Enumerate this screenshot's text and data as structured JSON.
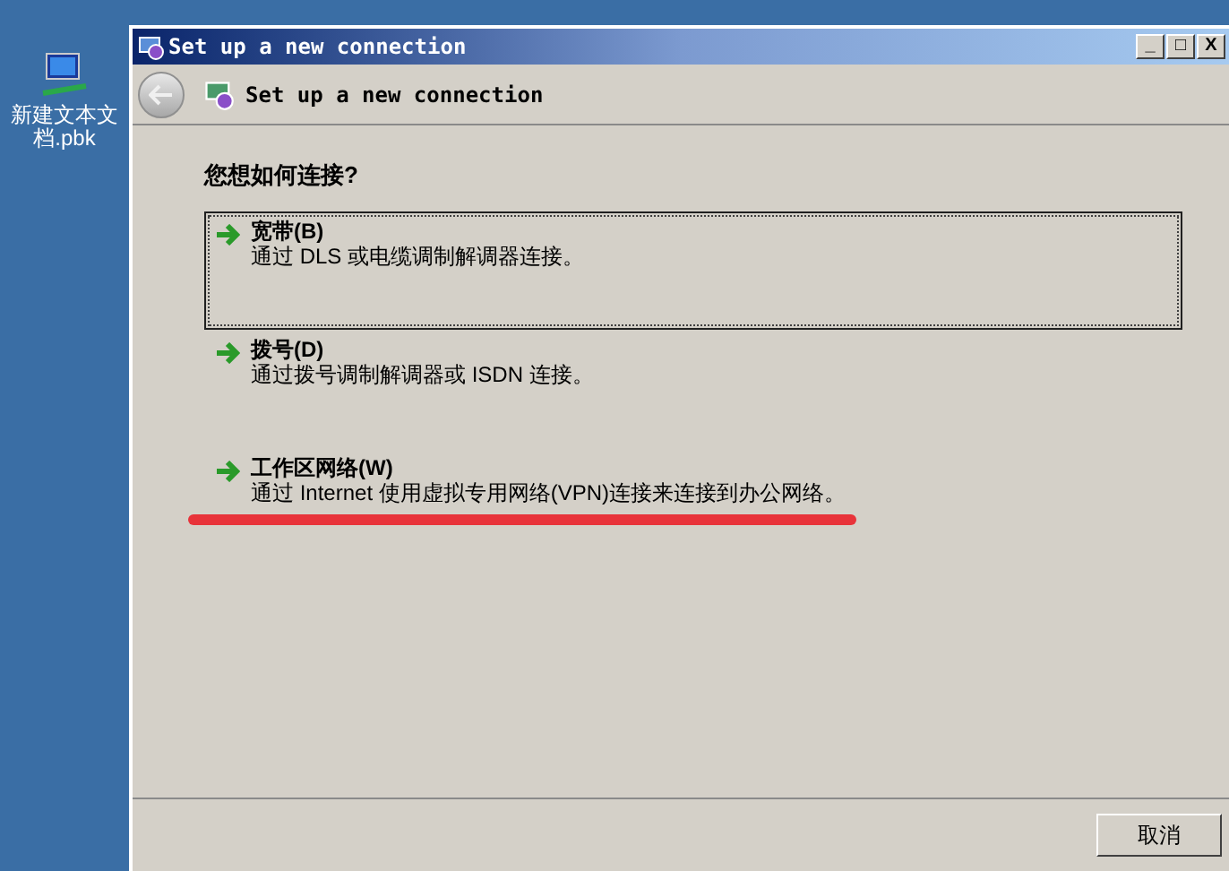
{
  "desktop": {
    "icons": [
      {
        "label": "新建文本文档.pbk"
      }
    ]
  },
  "window": {
    "title": "Set up a new connection",
    "controls": [
      "_",
      "□",
      "X"
    ]
  },
  "header": {
    "title": "Set up a new connection"
  },
  "question": "您想如何连接?",
  "options": [
    {
      "title": "宽带(B)",
      "description": "通过 DLS 或电缆调制解调器连接。",
      "selected": true
    },
    {
      "title": "拨号(D)",
      "description": "通过拨号调制解调器或 ISDN 连接。",
      "selected": false
    },
    {
      "title": "工作区网络(W)",
      "description": "通过 Internet 使用虚拟专用网络(VPN)连接来连接到办公网络。",
      "selected": false
    }
  ],
  "buttons": [
    "取消"
  ]
}
